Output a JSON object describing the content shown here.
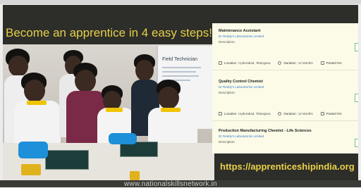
{
  "slide": {
    "headline": "Become an apprentice in 4 easy steps!",
    "url": "https://apprenticeshipindia.org"
  },
  "photo": {
    "poster_title": "Field Technician"
  },
  "jobs": [
    {
      "title": "Maintenance Assistant",
      "company": "Dr Reddy's Laboratories Limited",
      "description": "Description:",
      "location_label": "Location:",
      "location": "Hyderabad, Telangana",
      "duration_label": "Duration:",
      "duration": "12 Months",
      "posted_label": "Posted On:"
    },
    {
      "title": "Quality Control Chemist",
      "company": "Dr Reddy's Laboratories Limited",
      "description": "Description:",
      "location_label": "Location:",
      "location": "Hyderabad, Telangana",
      "duration_label": "Duration:",
      "duration": "12 Months",
      "posted_label": "Posted On:"
    },
    {
      "title": "Production Manufacturing Chemist - Life Sciences",
      "company": "Dr Reddy's Laboratories Limited",
      "description": "Description:"
    }
  ],
  "watermark": "www.nationalskillsnetwork.in",
  "colors": {
    "headline": "#e6d04a",
    "panel_bg": "#fbfbe8",
    "company_link": "#3a7bd5",
    "frame_bg": "#2d2d29"
  }
}
